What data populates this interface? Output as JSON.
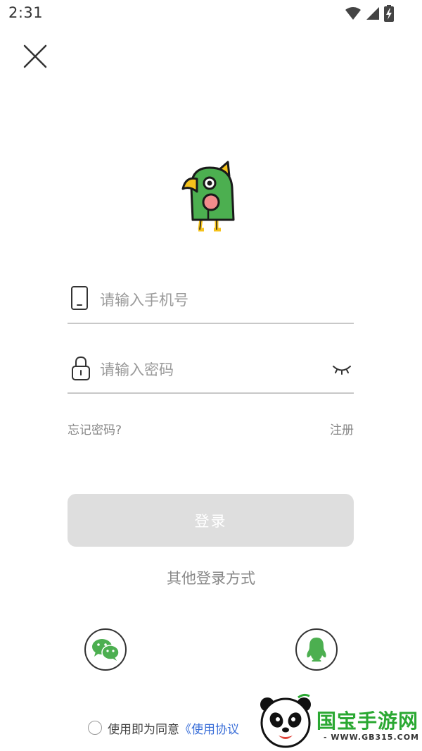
{
  "status_bar": {
    "time": "2:31"
  },
  "icons": {
    "close": "close-icon",
    "logo": "parrot-logo-icon",
    "phone": "phone-icon",
    "lock": "lock-icon",
    "eye": "eye-closed-icon",
    "wechat": "wechat-icon",
    "qq": "qq-icon"
  },
  "colors": {
    "parrot_green": "#4caf50",
    "login_button_disabled": "#dedede",
    "link_blue": "#3b6fd8",
    "watermark_green": "#2aa832"
  },
  "form": {
    "phone": {
      "placeholder": "请输入手机号",
      "value": ""
    },
    "password": {
      "placeholder": "请输入密码",
      "value": ""
    },
    "forgot_password": "忘记密码?",
    "register": "注册",
    "login_button": "登录"
  },
  "other_login": {
    "label": "其他登录方式"
  },
  "agreement": {
    "prefix": "使用即为同意",
    "link": "《使用协议"
  },
  "watermark": {
    "title": "国宝手游网",
    "url": "- WWW.GB315.COM -"
  }
}
